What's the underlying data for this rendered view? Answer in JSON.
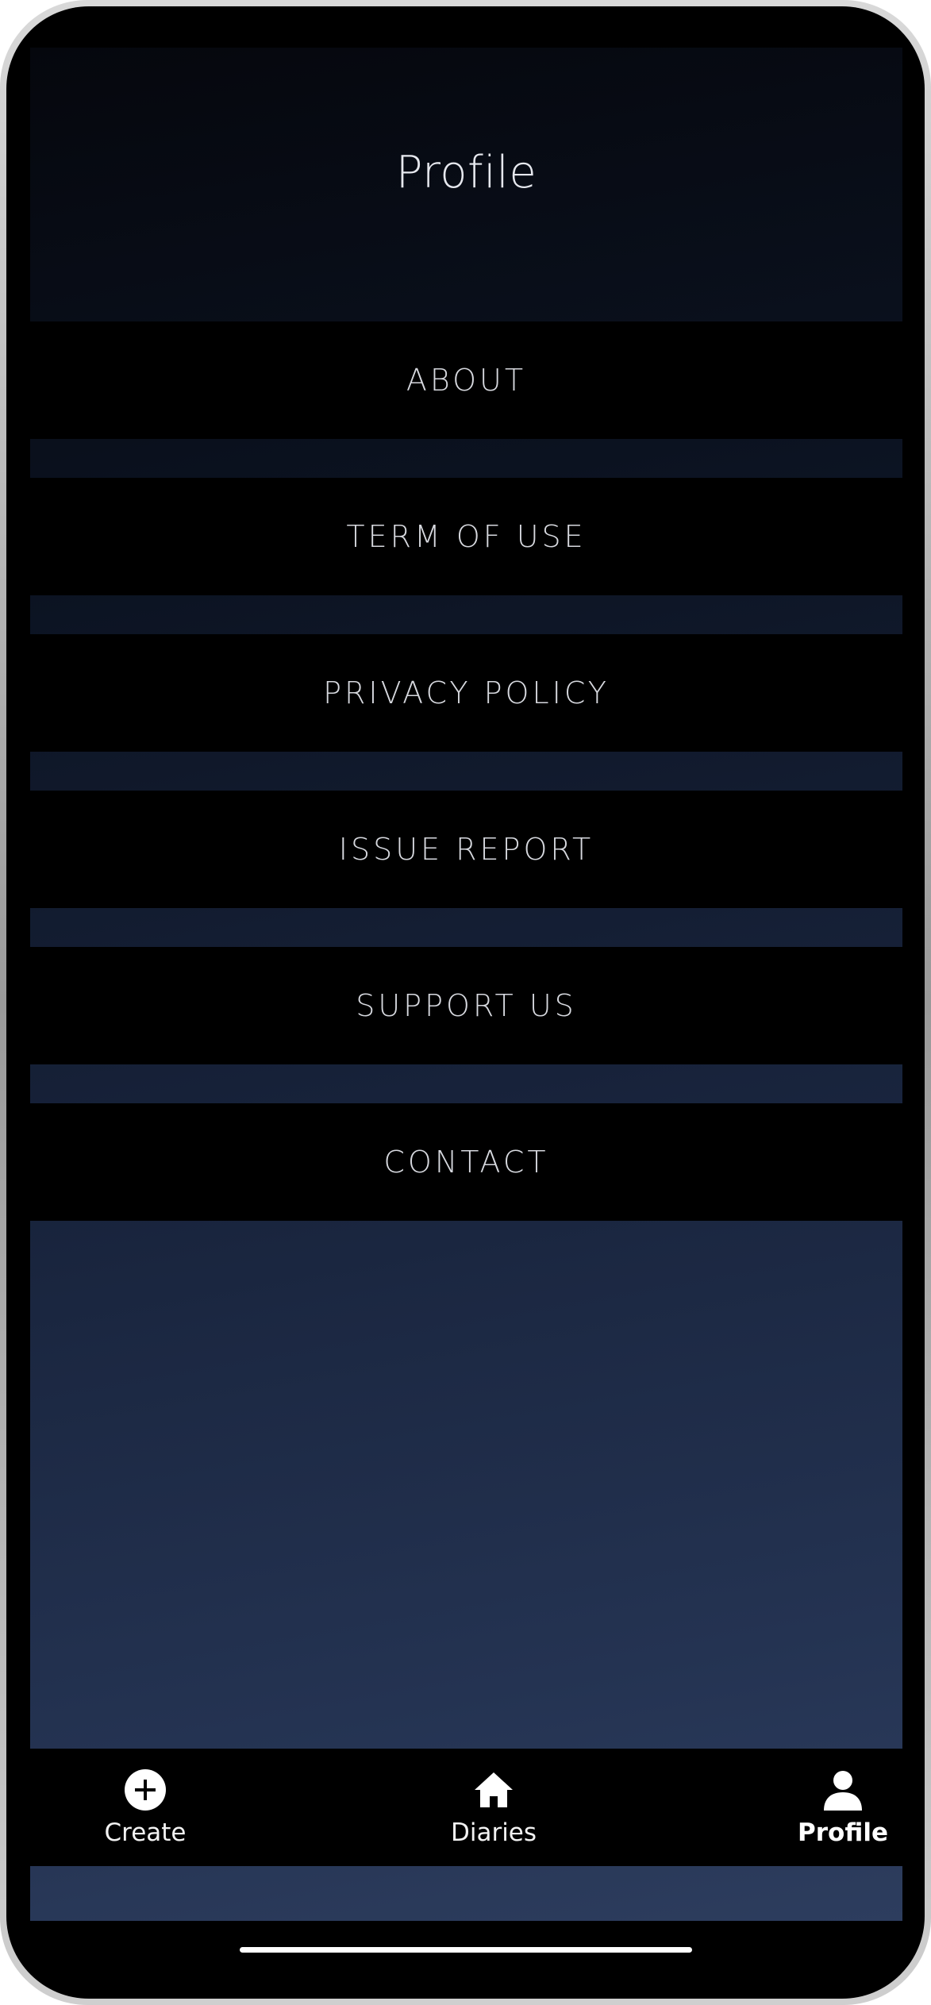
{
  "header": {
    "title": "Profile"
  },
  "menu": {
    "items": [
      {
        "label": "ABOUT"
      },
      {
        "label": "TERM OF USE"
      },
      {
        "label": "PRIVACY POLICY"
      },
      {
        "label": "ISSUE REPORT"
      },
      {
        "label": "SUPPORT US"
      },
      {
        "label": "CONTACT"
      }
    ]
  },
  "tabbar": {
    "tabs": [
      {
        "label": "Create",
        "icon": "plus-circle-icon"
      },
      {
        "label": "Diaries",
        "icon": "home-icon"
      },
      {
        "label": "Profile",
        "icon": "person-icon",
        "active": true
      }
    ]
  },
  "colors": {
    "background_top": "#05070d",
    "background_bottom": "#2d3d5e",
    "menu_item_bg": "#000000",
    "menu_text": "#d7d9df"
  }
}
